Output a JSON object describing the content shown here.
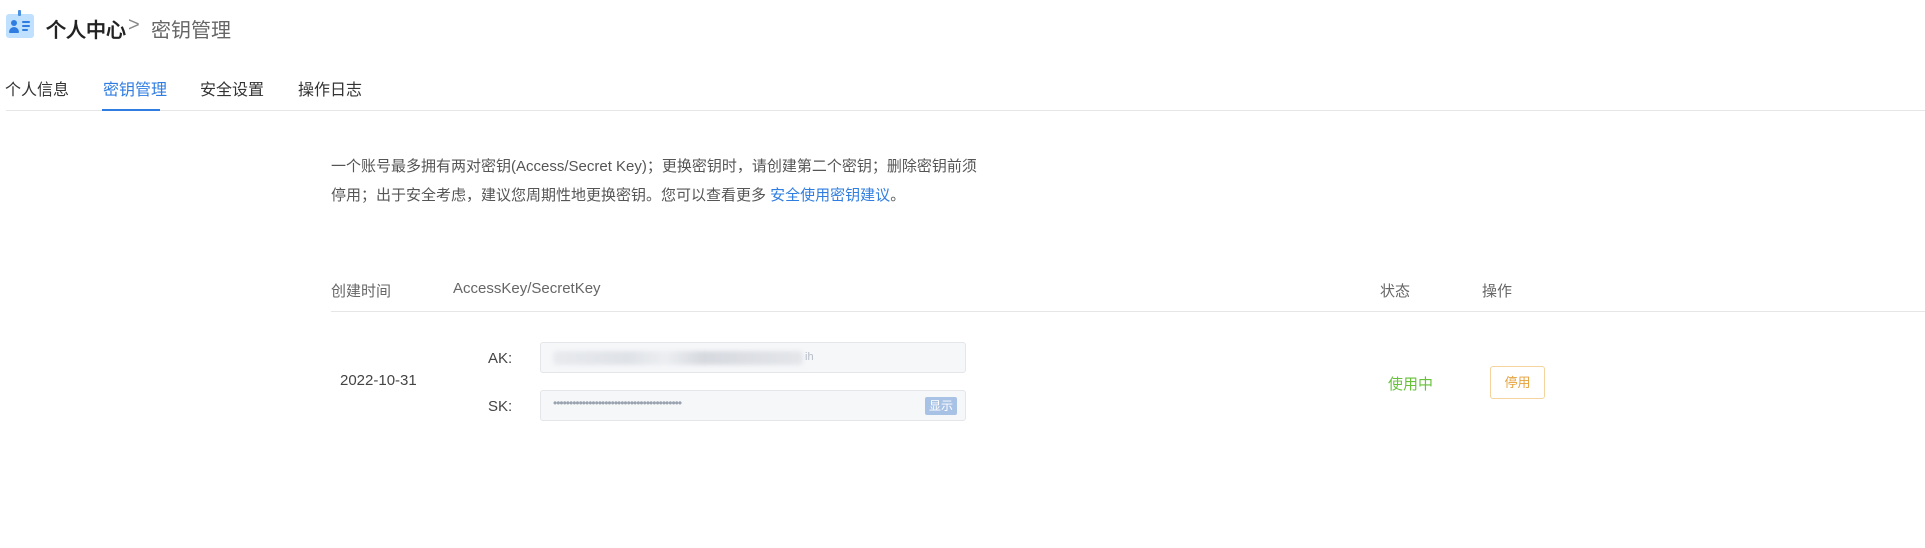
{
  "breadcrumb": {
    "root": "个人中心",
    "separator": ">",
    "current": "密钥管理",
    "icon": "id-card-icon"
  },
  "tabs": [
    {
      "label": "个人信息",
      "active": false
    },
    {
      "label": "密钥管理",
      "active": true
    },
    {
      "label": "安全设置",
      "active": false
    },
    {
      "label": "操作日志",
      "active": false
    }
  ],
  "notice": {
    "text": "一个账号最多拥有两对密钥(Access/Secret Key)；更换密钥时，请创建第二个密钥；删除密钥前须停用；出于安全考虑，建议您周期性地更换密钥。您可以查看更多 ",
    "link": "安全使用密钥建议",
    "suffix": "。"
  },
  "table": {
    "columns": {
      "created": "创建时间",
      "keys": "AccessKey/SecretKey",
      "status": "状态",
      "action": "操作"
    },
    "rows": [
      {
        "created": "2022-10-31",
        "ak_label": "AK:",
        "ak_value_tail": "ih",
        "sk_label": "SK:",
        "sk_value": "••••••••••••••••••••••••••••••••••••••••",
        "show_label": "显示",
        "status": "使用中",
        "action_label": "停用"
      }
    ]
  },
  "colors": {
    "accent": "#2f7de1",
    "status_active": "#67c23a",
    "warning": "#e6a23c"
  }
}
